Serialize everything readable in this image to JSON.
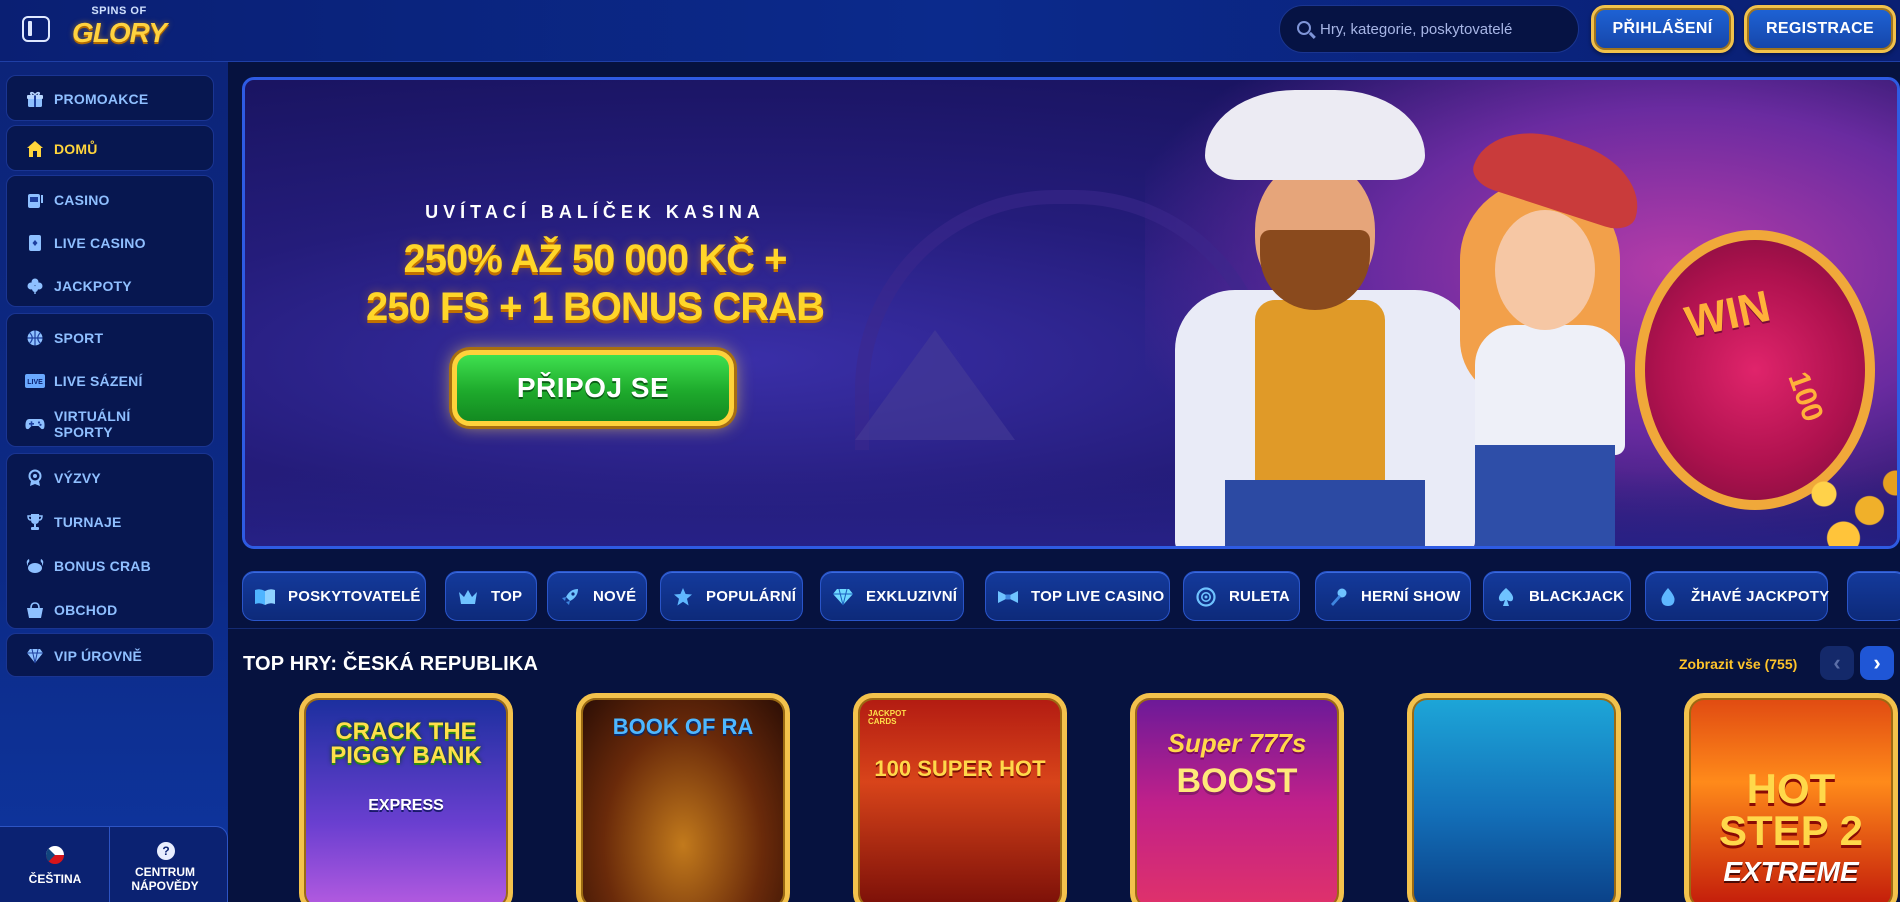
{
  "header": {
    "logo_top": "SPINS OF",
    "logo_main": "GLORY",
    "search_placeholder": "Hry, kategorie, poskytovatelé",
    "login_label": "PŘIHLÁŠENÍ",
    "register_label": "REGISTRACE"
  },
  "sidebar": {
    "items": [
      {
        "label": "PROMOAKCE",
        "icon": "gift-icon"
      },
      {
        "label": "DOMŮ",
        "icon": "home-icon",
        "active": true
      },
      {
        "label": "CASINO",
        "icon": "slot-machine-icon"
      },
      {
        "label": "LIVE CASINO",
        "icon": "playing-card-icon"
      },
      {
        "label": "JACKPOTY",
        "icon": "clover-icon"
      },
      {
        "label": "SPORT",
        "icon": "basketball-icon"
      },
      {
        "label": "LIVE SÁZENÍ",
        "icon": "live-badge-icon"
      },
      {
        "label": "VIRTUÁLNÍ SPORTY",
        "icon": "gamepad-icon"
      },
      {
        "label": "VÝZVY",
        "icon": "challenge-icon"
      },
      {
        "label": "TURNAJE",
        "icon": "trophy-icon"
      },
      {
        "label": "BONUS CRAB",
        "icon": "crab-icon"
      },
      {
        "label": "OBCHOD",
        "icon": "basket-icon"
      },
      {
        "label": "VIP ÚROVNĚ",
        "icon": "diamond-icon"
      }
    ],
    "footer": {
      "language_label": "ČEŠTINA",
      "help_label": "CENTRUM NÁPOVĚDY",
      "help_glyph": "?"
    }
  },
  "banner": {
    "kicker": "UVÍTACÍ BALÍČEK KASINA",
    "headline_line1": "250% AŽ 50 000 KČ +",
    "headline_line2": "250 FS + 1 BONUS CRAB",
    "cta_label": "PŘIPOJ SE",
    "wheel_win": "WIN",
    "wheel_100": "100"
  },
  "categories": [
    {
      "label": "POSKYTOVATELÉ",
      "icon": "book-icon"
    },
    {
      "label": "TOP",
      "icon": "crown-icon"
    },
    {
      "label": "NOVÉ",
      "icon": "rocket-icon"
    },
    {
      "label": "POPULÁRNÍ",
      "icon": "star-icon"
    },
    {
      "label": "EXKLUZIVNÍ",
      "icon": "gem-icon"
    },
    {
      "label": "TOP LIVE CASINO",
      "icon": "bowtie-icon"
    },
    {
      "label": "RULETA",
      "icon": "roulette-icon"
    },
    {
      "label": "HERNÍ SHOW",
      "icon": "microphone-icon"
    },
    {
      "label": "BLACKJACK",
      "icon": "spade-icon"
    },
    {
      "label": "ŽHAVÉ JACKPOTY",
      "icon": "flame-drop-icon"
    }
  ],
  "top_games": {
    "title": "TOP HRY: ČESKÁ REPUBLIKA",
    "view_all": "Zobrazit vše (755)",
    "games": [
      {
        "title": "CRACK THE PIGGY BANK",
        "subtitle": "EXPRESS"
      },
      {
        "title": "BOOK OF RA",
        "subtitle": ""
      },
      {
        "title": "100 SUPER HOT",
        "subtitle": "JACKPOT CARDS"
      },
      {
        "title": "Super 777s",
        "subtitle": "BOOST"
      },
      {
        "title": "",
        "subtitle": ""
      },
      {
        "title": "HOT STEP 2",
        "subtitle": "EXTREME"
      }
    ]
  },
  "colors": {
    "accent_gold": "#ffd629",
    "nav_text": "#8fbfff",
    "active_nav": "#ffd53c",
    "cta_green": "#1eaa2c"
  }
}
